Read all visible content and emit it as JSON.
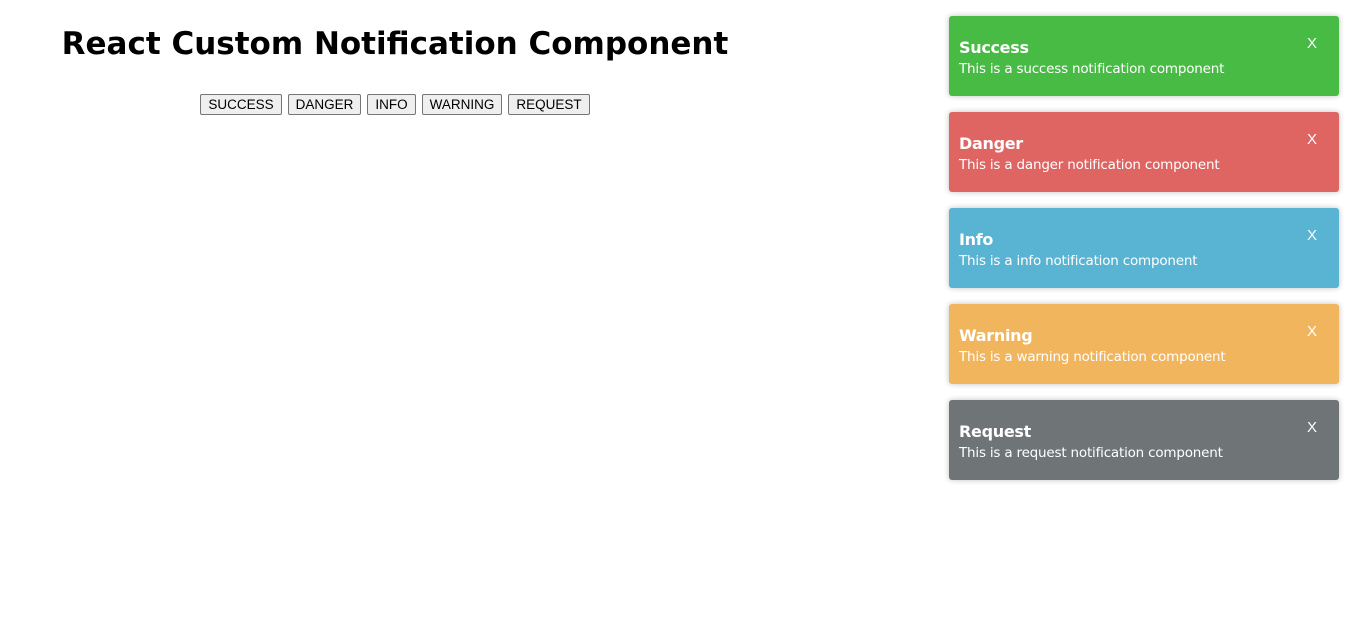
{
  "page": {
    "title": "React Custom Notification Component"
  },
  "buttons": [
    {
      "label": "SUCCESS"
    },
    {
      "label": "DANGER"
    },
    {
      "label": "INFO"
    },
    {
      "label": "WARNING"
    },
    {
      "label": "REQUEST"
    }
  ],
  "toasts": [
    {
      "title": "Success",
      "message": "This is a success notification component",
      "close_label": "X",
      "color": "#48bb45"
    },
    {
      "title": "Danger",
      "message": "This is a danger notification component",
      "close_label": "X",
      "color": "#de6561"
    },
    {
      "title": "Info",
      "message": "This is a info notification component",
      "close_label": "X",
      "color": "#58b4d2"
    },
    {
      "title": "Warning",
      "message": "This is a warning notification component",
      "close_label": "X",
      "color": "#f1b55e"
    },
    {
      "title": "Request",
      "message": "This is a request notification component",
      "close_label": "X",
      "color": "#6f7476"
    }
  ]
}
